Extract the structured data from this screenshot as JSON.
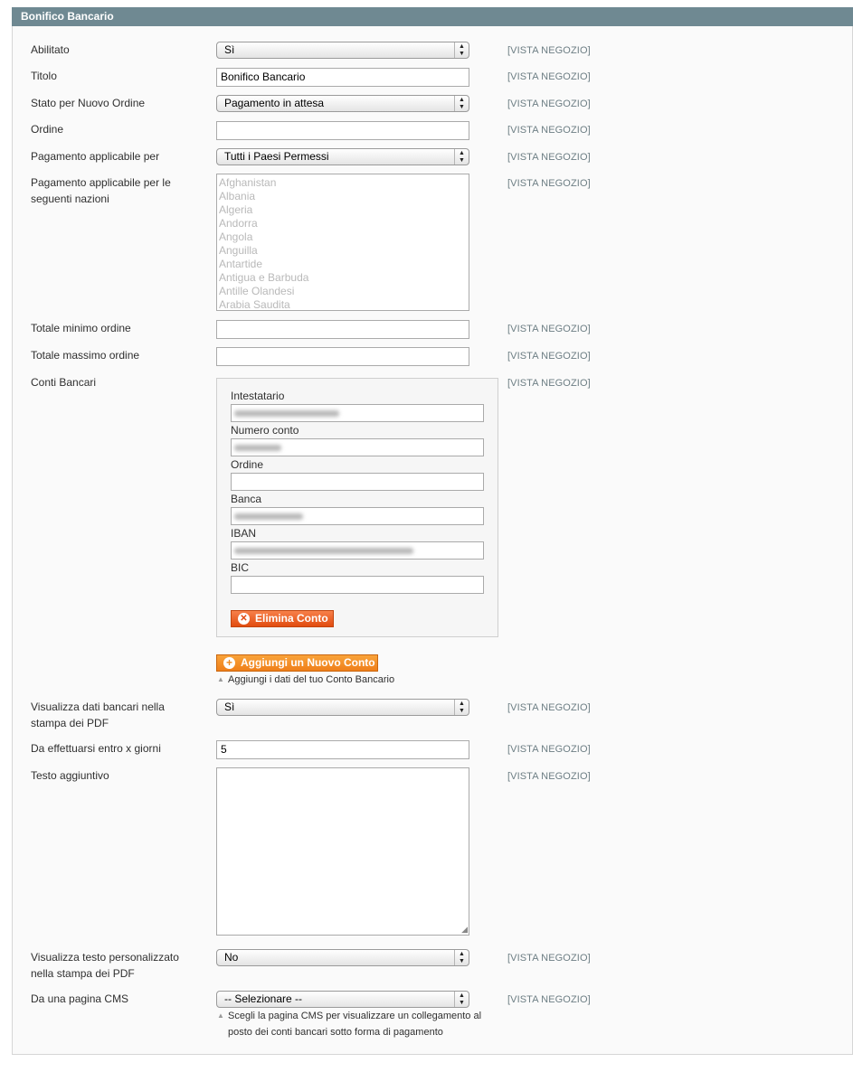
{
  "section": {
    "title": "Bonifico Bancario"
  },
  "scope_label": "[VISTA NEGOZIO]",
  "fields": {
    "abilitato": {
      "label": "Abilitato",
      "value": "Sì"
    },
    "titolo": {
      "label": "Titolo",
      "value": "Bonifico Bancario"
    },
    "stato_ordine": {
      "label": "Stato per Nuovo Ordine",
      "value": "Pagamento in attesa"
    },
    "ordine": {
      "label": "Ordine",
      "value": ""
    },
    "pagamento_applicabile": {
      "label": "Pagamento applicabile per",
      "value": "Tutti i Paesi Permessi"
    },
    "nazioni": {
      "label_line1": "Pagamento applicabile per le",
      "label_line2": "seguenti nazioni",
      "options": [
        "Afghanistan",
        "Albania",
        "Algeria",
        "Andorra",
        "Angola",
        "Anguilla",
        "Antartide",
        "Antigua e Barbuda",
        "Antille Olandesi",
        "Arabia Saudita"
      ]
    },
    "totale_minimo": {
      "label": "Totale minimo ordine",
      "value": ""
    },
    "totale_massimo": {
      "label": "Totale massimo ordine",
      "value": ""
    },
    "conti_bancari": {
      "label": "Conti Bancari",
      "intestatario_label": "Intestatario",
      "numero_conto_label": "Numero conto",
      "ordine_label": "Ordine",
      "banca_label": "Banca",
      "iban_label": "IBAN",
      "bic_label": "BIC",
      "delete_button": "Elimina Conto",
      "add_button": "Aggiungi un Nuovo Conto",
      "add_note": "Aggiungi i dati del tuo Conto Bancario"
    },
    "visualizza_pdf": {
      "label_line1": "Visualizza dati bancari nella",
      "label_line2": "stampa dei PDF",
      "value": "Sì"
    },
    "giorni": {
      "label": "Da effettuarsi entro x giorni",
      "value": "5"
    },
    "testo_aggiuntivo": {
      "label": "Testo aggiuntivo",
      "value": ""
    },
    "testo_pdf": {
      "label_line1": "Visualizza testo personalizzato",
      "label_line2": "nella stampa dei PDF",
      "value": "No"
    },
    "pagina_cms": {
      "label": "Da una pagina CMS",
      "value": "-- Selezionare --",
      "note_line1": "Scegli la pagina CMS per visualizzare un collegamento al",
      "note_line2": "posto dei conti bancari sotto forma di pagamento"
    }
  }
}
